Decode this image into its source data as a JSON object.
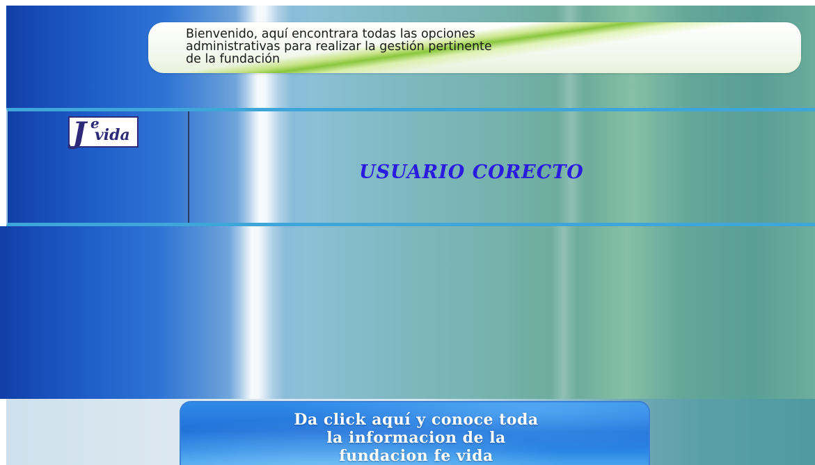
{
  "header": {
    "welcome_text": "Bienvenido, aquí encontrara todas las opciones\nadministrativas para realizar la gestión pertinente\nde la fundación"
  },
  "logo": {
    "letter": "J",
    "superscript": "e",
    "word": "vida"
  },
  "status": {
    "message": "USUARIO CORECTO"
  },
  "info_button": {
    "label": "Da click aquí y conoce toda\nla informacion de la\nfundacion fe vida"
  },
  "colors": {
    "accent_line": "#3ea6d8",
    "status_text": "#2a1be0",
    "logo_ink": "#2d2a7a",
    "button_blue": "#1f6fd8"
  }
}
